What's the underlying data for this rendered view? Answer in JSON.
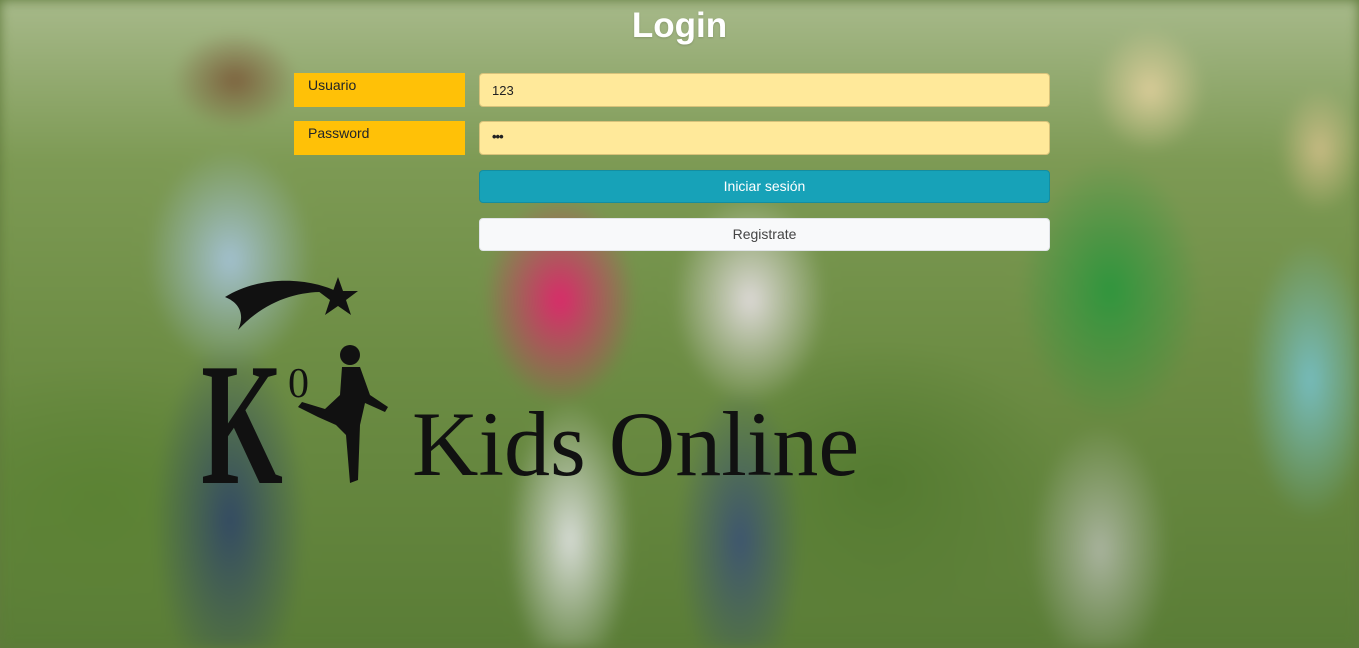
{
  "page": {
    "title": "Login"
  },
  "form": {
    "usuario_label": "Usuario",
    "usuario_value": "123",
    "password_label": "Password",
    "password_value": "•••",
    "login_button": "Iniciar sesión",
    "register_button": "Registrate"
  },
  "logo": {
    "text": "Kids Online",
    "monogram": "K",
    "superscript": "0"
  },
  "colors": {
    "label_bg": "#ffc107",
    "input_bg": "#ffe99a",
    "primary": "#17a2b8",
    "light": "#f8f9fa"
  }
}
